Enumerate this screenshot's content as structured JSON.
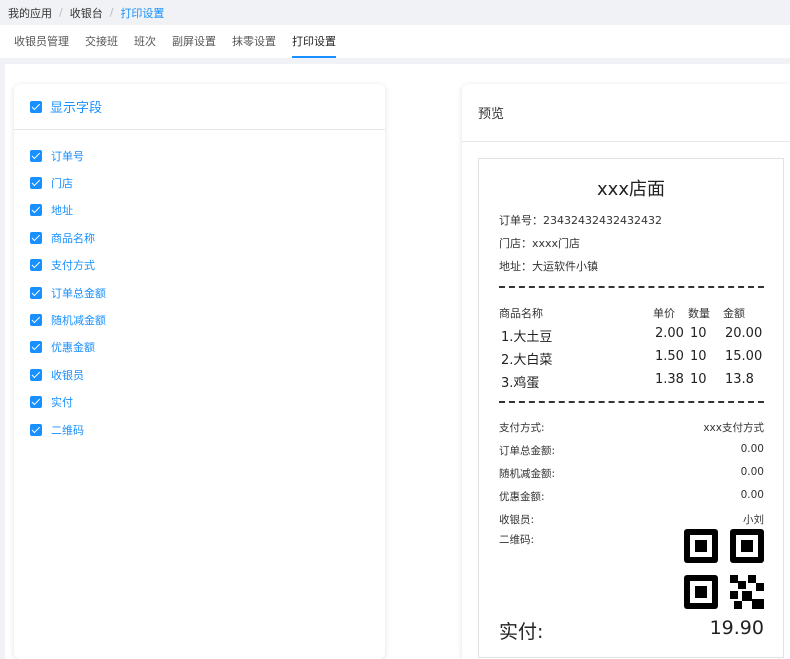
{
  "breadcrumb": [
    "我的应用",
    "收银台",
    "打印设置"
  ],
  "tabs": [
    "收银员管理",
    "交接班",
    "班次",
    "副屏设置",
    "抹零设置",
    "打印设置"
  ],
  "left_panel": {
    "title": "显示字段",
    "fields": [
      "订单号",
      "门店",
      "地址",
      "商品名称",
      "支付方式",
      "订单总金额",
      "随机减金额",
      "优惠金额",
      "收银员",
      "实付",
      "二维码"
    ]
  },
  "preview": {
    "title": "预览",
    "store_name": "xxx店面",
    "order_no": "订单号：23432432432432432",
    "store": "门店：xxxx门店",
    "address": "地址：大运软件小镇",
    "table_header": [
      "商品名称",
      "单价",
      "数量",
      "金额"
    ],
    "items": [
      {
        "name": "1.大土豆",
        "price": "2.00",
        "qty": "10",
        "amount": "20.00"
      },
      {
        "name": "2.大白菜",
        "price": "1.50",
        "qty": "10",
        "amount": "15.00"
      },
      {
        "name": "3.鸡蛋",
        "price": "1.38",
        "qty": "10",
        "amount": "13.8"
      }
    ],
    "summary": [
      {
        "label": "支付方式:",
        "value": "xxx支付方式"
      },
      {
        "label": "订单总金额:",
        "value": "0.00"
      },
      {
        "label": "随机减金额:",
        "value": "0.00"
      },
      {
        "label": "优惠金额:",
        "value": "0.00"
      },
      {
        "label": "收银员:",
        "value": "小刘"
      },
      {
        "label": "二维码:",
        "value": ""
      }
    ],
    "paid_label": "实付:",
    "paid_value": "19.90"
  },
  "colors": {
    "accent": "#1890ff"
  }
}
